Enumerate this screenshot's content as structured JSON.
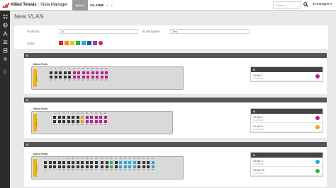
{
  "topbar": {
    "brand": "Allied Telesis",
    "product": "Vista Manager",
    "back_label": "Back",
    "crumb_device": "Yat ATMF",
    "crumb_icon": "home-icon",
    "search_placeholder": "Search",
    "user": "manager"
  },
  "sidebar": {
    "icons": [
      "dashboard-icon",
      "globe-icon",
      "network-icon",
      "list-icon",
      "server-icon",
      "gear-icon",
      "book-icon"
    ]
  },
  "page": {
    "title": "New VLAN"
  },
  "form": {
    "vlan_id_label": "VLAN ID",
    "vlan_id_value": "44",
    "vlan_name_label": "VLAN Name",
    "vlan_name_value": "Test",
    "color_label": "Color",
    "colors": [
      "#d9262b",
      "#f28c28",
      "#f0c419",
      "#2bb24c",
      "#2aa7d8",
      "#1f4fa8",
      "#8e44ad"
    ],
    "disabled_color_icon": "no-color-icon"
  },
  "sections": [
    {
      "title": "S",
      "select_ports_label": "Select Ports",
      "switch_tag": "x930-28GTX",
      "rows": 2,
      "ports_per_row": 13,
      "top_numbers": [
        "1",
        "3",
        "5",
        "7",
        "9",
        "11",
        "13",
        "15",
        "17",
        "19",
        "21",
        "23",
        "25"
      ],
      "bottom_numbers": [
        "2",
        "4",
        "6",
        "8",
        "10",
        "12",
        "14",
        "16",
        "18",
        "20",
        "22",
        "24",
        "26"
      ],
      "port_colors": [
        [
          "#333",
          "#333",
          "#333",
          "#333",
          "#333",
          "#bb1f8e",
          "#bb1f8e",
          "#bb1f8e",
          "#bb1f8e",
          "#bb1f8e",
          "#bb1f8e",
          "#bb1f8e",
          "#bb1f8e"
        ],
        [
          "#333",
          "#333",
          "#333",
          "#333",
          "#333",
          "#bb1f8e",
          "#bb1f8e",
          "#bb1f8e",
          "#bb1f8e",
          "#bb1f8e",
          "#bb1f8e",
          "#bb1f8e",
          "#bb1f8e"
        ]
      ],
      "panel": {
        "title": "S",
        "vlans": [
          {
            "name": "VLAN 1",
            "sub": "VLAN0001",
            "color": "#bb1f8e"
          }
        ]
      }
    },
    {
      "title": "S",
      "select_ports_label": "Select Ports",
      "switch_tag": "x510-28GTX",
      "rows": 2,
      "ports_per_row": 12,
      "top_numbers": [
        "1",
        "3",
        "5",
        "7",
        "9",
        "11",
        "13",
        "15",
        "17",
        "19",
        "21",
        "23"
      ],
      "bottom_numbers": [
        "2",
        "4",
        "6",
        "8",
        "10",
        "12",
        "14",
        "16",
        "18",
        "20",
        "22",
        "24"
      ],
      "port_colors": [
        [
          "#333",
          "#333",
          "#333",
          "#333",
          "#333",
          "#333",
          "#f0a020",
          "#bb1f8e",
          "#bb1f8e",
          "#bb1f8e",
          "#bb1f8e",
          "#bb1f8e"
        ],
        [
          "#333",
          "#333",
          "#333",
          "#333",
          "#333",
          "#333",
          "#f0a020",
          "#bb1f8e",
          "#bb1f8e",
          "#bb1f8e",
          "#bb1f8e",
          "#bb1f8e"
        ]
      ],
      "panel": {
        "title": "S",
        "vlans": [
          {
            "name": "VLAN 2",
            "sub": "VLAN0002",
            "color": "#bb1f8e"
          },
          {
            "name": "VLAN 5",
            "sub": "VLAN0005",
            "color": "#f0a020"
          }
        ]
      }
    },
    {
      "title": "S",
      "select_ports_label": "Select Ports",
      "switch_tag": "x930-52GPX",
      "rows": 2,
      "ports_per_row": 24,
      "top_numbers": [
        "1",
        "3",
        "5",
        "7",
        "9",
        "11",
        "13",
        "15",
        "17",
        "19",
        "21",
        "23",
        "25",
        "27",
        "29",
        "31",
        "33",
        "35",
        "37",
        "39",
        "41",
        "43",
        "45",
        "47"
      ],
      "bottom_numbers": [
        "2",
        "4",
        "6",
        "8",
        "10",
        "12",
        "14",
        "16",
        "18",
        "20",
        "22",
        "24",
        "26",
        "28",
        "30",
        "32",
        "34",
        "36",
        "38",
        "40",
        "42",
        "44",
        "46",
        "48"
      ],
      "port_colors": [
        [
          "#333",
          "#333",
          "#333",
          "#333",
          "#333",
          "#333",
          "#333",
          "#333",
          "#333",
          "#333",
          "#333",
          "#333",
          "#333",
          "#333",
          "#2bb24c",
          "#333",
          "#2aa7d8",
          "#2aa7d8",
          "#2aa7d8",
          "#2aa7d8",
          "#333",
          "#333",
          "#333",
          "#2aa7d8"
        ],
        [
          "#333",
          "#333",
          "#333",
          "#333",
          "#333",
          "#333",
          "#333",
          "#333",
          "#333",
          "#333",
          "#333",
          "#333",
          "#333",
          "#333",
          "#2bb24c",
          "#333",
          "#2aa7d8",
          "#2aa7d8",
          "#2aa7d8",
          "#2aa7d8",
          "#333",
          "#333",
          "#333",
          "#2aa7d8"
        ]
      ],
      "panel": {
        "title": "S",
        "vlans": [
          {
            "name": "VLAN 3",
            "sub": "VLAN0003",
            "color": "#2aa7d8"
          },
          {
            "name": "VLAN 20",
            "sub": "VLAN0020",
            "color": "#2bb24c"
          }
        ]
      }
    }
  ]
}
